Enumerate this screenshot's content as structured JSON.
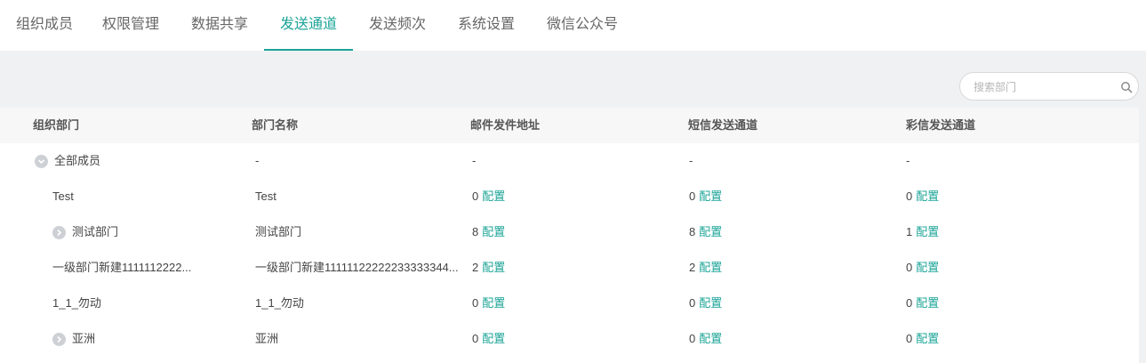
{
  "tabs": [
    {
      "label": "组织成员",
      "active": false
    },
    {
      "label": "权限管理",
      "active": false
    },
    {
      "label": "数据共享",
      "active": false
    },
    {
      "label": "发送通道",
      "active": true
    },
    {
      "label": "发送频次",
      "active": false
    },
    {
      "label": "系统设置",
      "active": false
    },
    {
      "label": "微信公众号",
      "active": false
    }
  ],
  "search": {
    "placeholder": "搜索部门",
    "icon": "search-icon"
  },
  "table": {
    "headers": [
      "组织部门",
      "部门名称",
      "邮件发件地址",
      "短信发送通道",
      "彩信发送通道"
    ],
    "config_label": "配置",
    "rows": [
      {
        "org": "全部成员",
        "name": "-",
        "email": "-",
        "sms": "-",
        "mms": "-",
        "expander": "collapse",
        "indent": 1
      },
      {
        "org": "Test",
        "name": "Test",
        "email": "0",
        "sms": "0",
        "mms": "0",
        "expander": "none",
        "indent": 2
      },
      {
        "org": "测试部门",
        "name": "测试部门",
        "email": "8",
        "sms": "8",
        "mms": "1",
        "expander": "expand",
        "indent": 2
      },
      {
        "org": "一级部门新建1111112222...",
        "name": "一级部门新建11111122222233333344...",
        "email": "2",
        "sms": "2",
        "mms": "0",
        "expander": "none",
        "indent": 2
      },
      {
        "org": "1_1_勿动",
        "name": "1_1_勿动",
        "email": "0",
        "sms": "0",
        "mms": "0",
        "expander": "none",
        "indent": 2
      },
      {
        "org": "亚洲",
        "name": "亚洲",
        "email": "0",
        "sms": "0",
        "mms": "0",
        "expander": "expand",
        "indent": 2
      }
    ]
  },
  "colors": {
    "accent": "#1ba497",
    "panel_bg": "#f0f1f3",
    "header_bg": "#f7f7f7"
  }
}
